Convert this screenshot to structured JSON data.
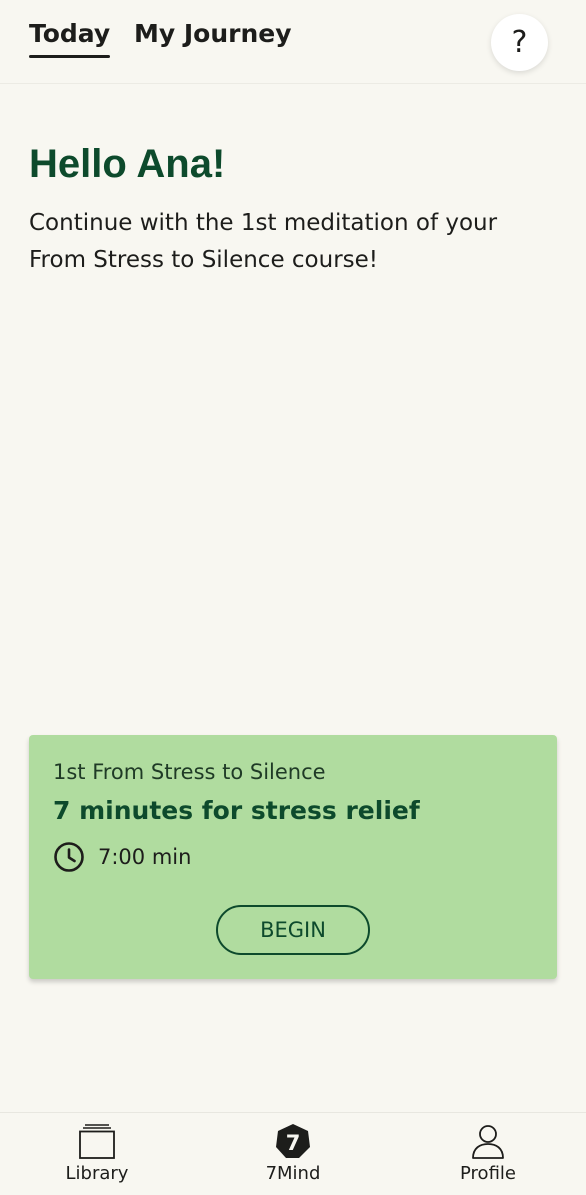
{
  "header": {
    "tabs": [
      {
        "label": "Today",
        "active": true
      },
      {
        "label": "My Journey",
        "active": false
      }
    ],
    "help_icon": "question-mark-icon",
    "help_glyph": "?"
  },
  "main": {
    "greeting": "Hello Ana!",
    "intro": "Continue with the 1st meditation of your From Stress to Silence course!"
  },
  "card": {
    "course_label": "1st From Stress to Silence",
    "title": "7 minutes for stress relief",
    "duration_icon": "clock-icon",
    "duration": "7:00 min",
    "begin_label": "BEGIN",
    "background_color": "#b0dc9f"
  },
  "bottom_nav": {
    "items": [
      {
        "label": "Library",
        "icon": "library-icon"
      },
      {
        "label": "7Mind",
        "icon": "7mind-logo-icon",
        "logo_text": "7"
      },
      {
        "label": "Profile",
        "icon": "profile-icon"
      }
    ]
  },
  "colors": {
    "background": "#f8f7f1",
    "accent_dark_green": "#0d4a2c",
    "card_green": "#b0dc9f",
    "text": "#1d1d1b"
  }
}
